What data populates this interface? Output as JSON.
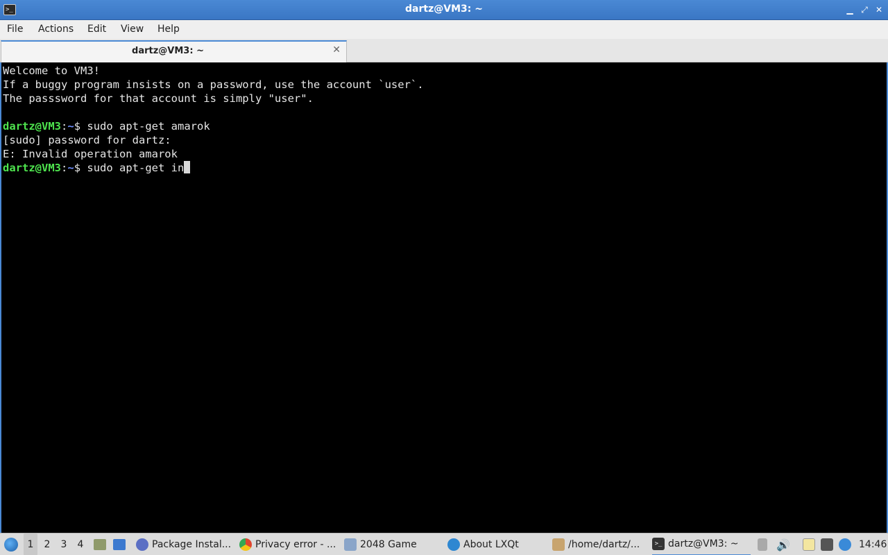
{
  "window": {
    "title": "dartz@VM3: ~",
    "controls": {
      "minimize": "▁",
      "maximize": "⤢",
      "close": "✕"
    }
  },
  "menubar": {
    "items": [
      "File",
      "Actions",
      "Edit",
      "View",
      "Help"
    ]
  },
  "tabs": [
    {
      "label": "dartz@VM3: ~",
      "close": "✕"
    }
  ],
  "terminal": {
    "motd": [
      "Welcome to VM3!",
      "If a buggy program insists on a password, use the account `user`.",
      "The passsword for that account is simply \"user\"."
    ],
    "prompt": {
      "user_host": "dartz@VM3",
      "sep": ":",
      "path": "~",
      "symbol": "$ "
    },
    "commands": [
      "sudo apt-get amarok",
      "sudo apt-get in"
    ],
    "output": [
      "[sudo] password for dartz:",
      "E: Invalid operation amarok"
    ]
  },
  "taskbar": {
    "desktops": [
      "1",
      "2",
      "3",
      "4"
    ],
    "active_desktop": "1",
    "tasks": [
      {
        "label": "Package Instal...",
        "icon": "package-installer-icon",
        "color": "#5b6fc4"
      },
      {
        "label": "Privacy error - ...",
        "icon": "chrome-icon",
        "color": "#e0452f"
      },
      {
        "label": "2048 Game",
        "icon": "window-icon",
        "color": "#8aa5c9"
      },
      {
        "label": "About LXQt",
        "icon": "lxqt-icon",
        "color": "#2e87d1"
      },
      {
        "label": "/home/dartz/...",
        "icon": "file-manager-icon",
        "color": "#c8a46e"
      },
      {
        "label": "dartz@VM3: ~",
        "icon": "terminal-icon",
        "color": "#333333"
      }
    ],
    "clock": "14:46"
  },
  "colors": {
    "accent": "#4a89d4",
    "prompt_user": "#4ee44e",
    "prompt_path": "#6f8fff"
  }
}
